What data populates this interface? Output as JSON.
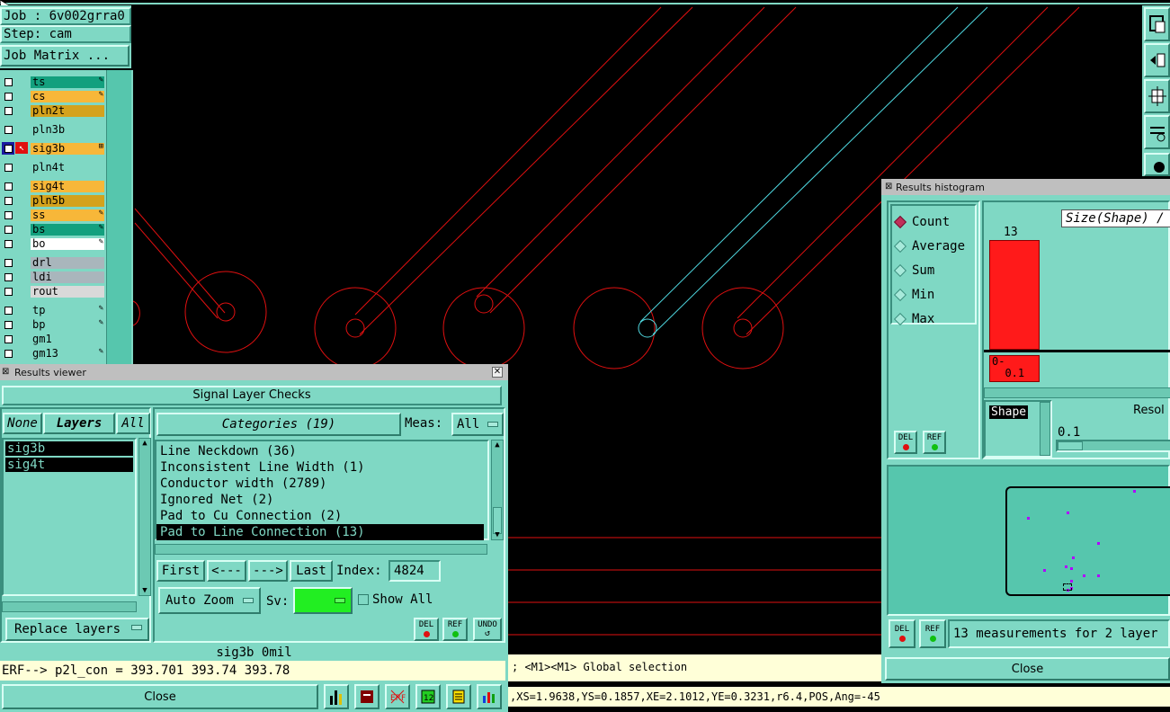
{
  "top_left": {
    "job_label": "Job : 6v002grra0",
    "step_label": "Step: cam",
    "job_matrix_button": "Job Matrix ..."
  },
  "layers": [
    {
      "name": "ts",
      "color": "#13a07e",
      "mark": "✎",
      "group": 1
    },
    {
      "name": "cs",
      "color": "#f7b739",
      "mark": "✎",
      "group": 1
    },
    {
      "name": "pln2t",
      "color": "#d4a21d",
      "mark": "",
      "group": 1
    },
    {
      "name": "pln3b",
      "color": "#7fd8c4",
      "mark": "",
      "group": 2
    },
    {
      "name": "sig3b",
      "color": "#f7b739",
      "mark": "⊞",
      "group": 3,
      "active": true
    },
    {
      "name": "pln4t",
      "color": "#7fd8c4",
      "mark": "",
      "group": 4
    },
    {
      "name": "sig4t",
      "color": "#f7b739",
      "mark": "",
      "group": 5
    },
    {
      "name": "pln5b",
      "color": "#d4a21d",
      "mark": "",
      "group": 5
    },
    {
      "name": "ss",
      "color": "#f7b739",
      "mark": "✎",
      "group": 5
    },
    {
      "name": "bs",
      "color": "#13a07e",
      "mark": "✎",
      "group": 5
    },
    {
      "name": "bo",
      "color": "#ffffff",
      "mark": "✎",
      "group": 5
    },
    {
      "name": "drl",
      "color": "#a9b6bc",
      "mark": "",
      "group": 6
    },
    {
      "name": "ldi",
      "color": "#a9b6bc",
      "mark": "",
      "group": 6
    },
    {
      "name": "rout",
      "color": "#d9d9d9",
      "mark": "",
      "group": 6
    },
    {
      "name": "tp",
      "color": "#7fd8c4",
      "mark": "✎",
      "group": 7
    },
    {
      "name": "bp",
      "color": "#7fd8c4",
      "mark": "✎",
      "group": 7
    },
    {
      "name": "gm1",
      "color": "#7fd8c4",
      "mark": "",
      "group": 7
    },
    {
      "name": "gm13",
      "color": "#7fd8c4",
      "mark": "✎",
      "group": 7
    }
  ],
  "results_viewer": {
    "title": "Results viewer",
    "header": "Signal Layer Checks",
    "none_button": "None",
    "layers_button": "Layers",
    "all_button": "All",
    "layer_list": [
      "sig3b",
      "sig4t"
    ],
    "categories_button": "Categories (19)",
    "meas_label": "Meas:",
    "meas_value": "All",
    "categories": [
      "Line Neckdown (36)",
      "Inconsistent Line Width (1)",
      "Conductor width (2789)",
      "Ignored Net (2)",
      "Pad to Cu Connection (2)",
      "Pad to Line Connection (13)"
    ],
    "selected_category_index": 5,
    "first_button": "First",
    "prev_button": "<---",
    "next_button": "--->",
    "last_button": "Last",
    "index_label": "Index:",
    "index_value": "4824",
    "auto_zoom_button": "Auto Zoom",
    "sv_label": "Sv:",
    "show_all_label": "Show All",
    "replace_layers_button": "Replace layers",
    "del_label": "DEL",
    "ref_label": "REF",
    "undo_label": "UNDO",
    "status_line": "sig3b 0mil",
    "erf_line": "ERF--> p2l_con = 393.701 393.74 393.78",
    "close_button": "Close"
  },
  "histogram": {
    "title": "Results histogram",
    "modes": [
      "Count",
      "Average",
      "Sum",
      "Min",
      "Max"
    ],
    "selected_mode": "Count",
    "size_label": "Size(Shape) /",
    "bar_value": "13",
    "bar_value_number": 13,
    "bin_label": "0-\n  0.1",
    "shape_label": "Shape",
    "resol_label": "Resol",
    "resol_value": "0.1",
    "del_label": "DEL",
    "ref_label": "REF",
    "measurements_text": "13 measurements for 2 layer",
    "close_button": "Close",
    "colors": {
      "bar": "#ff1a1a",
      "points": "#b000ff"
    }
  },
  "canvas_status": {
    "selection_text": "; <M1><M1> Global selection",
    "coords_text": ",XS=1.9638,YS=0.1857,XE=2.1012,YE=0.3231,r6.4,POS,Ang=-45"
  }
}
